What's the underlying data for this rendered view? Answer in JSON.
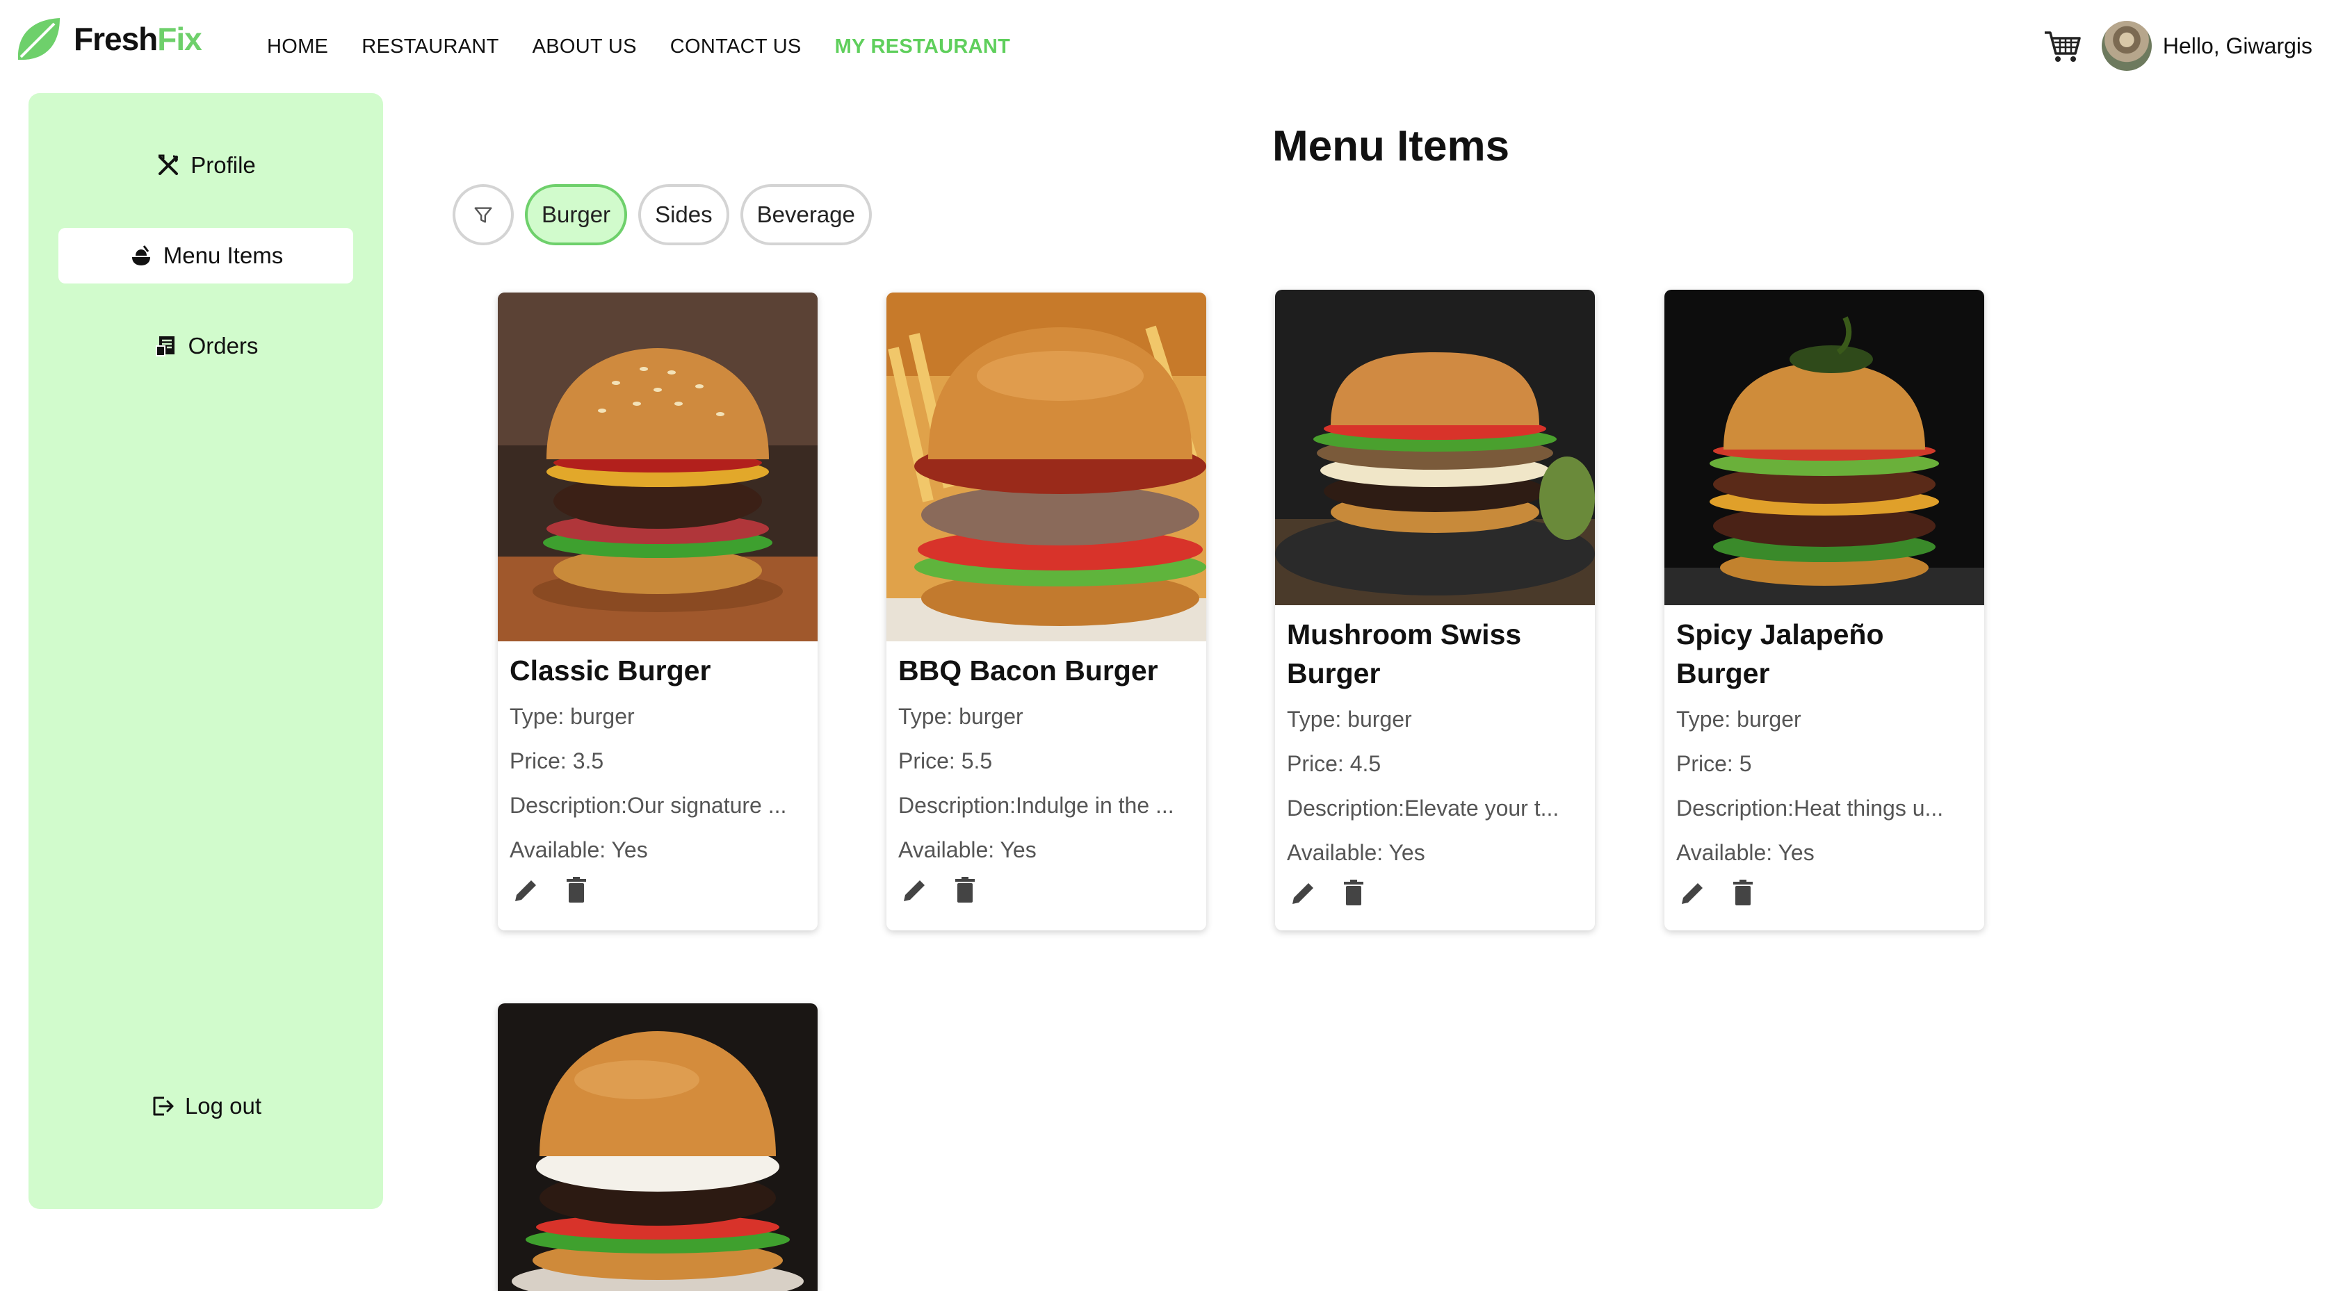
{
  "brand": {
    "name_part1": "Fresh",
    "name_part2": "Fix"
  },
  "nav": {
    "links": [
      {
        "label": "HOME",
        "active": false
      },
      {
        "label": "RESTAURANT",
        "active": false
      },
      {
        "label": "ABOUT US",
        "active": false
      },
      {
        "label": "CONTACT US",
        "active": false
      },
      {
        "label": "MY RESTAURANT",
        "active": true
      }
    ],
    "greeting": "Hello, Giwargis"
  },
  "sidebar": {
    "items": [
      {
        "label": "Profile",
        "icon": "utensils-cross-icon",
        "active": false
      },
      {
        "label": "Menu Items",
        "icon": "food-icon",
        "active": true
      },
      {
        "label": "Orders",
        "icon": "receipt-icon",
        "active": false
      }
    ],
    "logout": {
      "label": "Log out",
      "icon": "logout-icon"
    }
  },
  "main": {
    "title": "Menu Items",
    "filters": [
      {
        "label": "Burger",
        "selected": true
      },
      {
        "label": "Sides",
        "selected": false
      },
      {
        "label": "Beverage",
        "selected": false
      }
    ],
    "items": [
      {
        "name": "Classic Burger",
        "type": "Type: burger",
        "price": "Price: 3.5",
        "description": "Description:Our signature ...",
        "available": "Available: Yes"
      },
      {
        "name": "BBQ Bacon Burger",
        "type": "Type: burger",
        "price": "Price: 5.5",
        "description": "Description:Indulge in the ...",
        "available": "Available: Yes"
      },
      {
        "name": "Mushroom Swiss Burger",
        "type": "Type: burger",
        "price": "Price: 4.5",
        "description": "Description:Elevate your t...",
        "available": "Available: Yes"
      },
      {
        "name": "Spicy Jalapeño Burger",
        "type": "Type: burger",
        "price": "Price: 5",
        "description": "Description:Heat things u...",
        "available": "Available: Yes"
      }
    ]
  },
  "colors": {
    "accent": "#6ed06b",
    "sidebar_bg": "#d1fbcc",
    "active_nav": "#5fcf5c"
  }
}
